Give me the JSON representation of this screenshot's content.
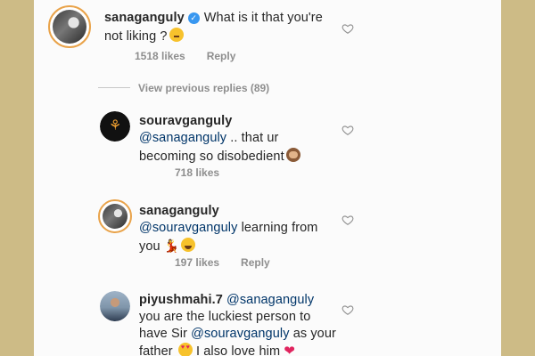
{
  "comments": [
    {
      "username": "sanaganguly",
      "verified": true,
      "text_line1": "What is it that you're",
      "text_line2": "not liking ?",
      "emoji": "thinking-face-icon",
      "likes": "1518 likes",
      "reply": "Reply"
    },
    {
      "username": "souravganguly",
      "mention": "@sanaganguly",
      "text_line1_rest": " .. that ur",
      "text_line2": "becoming so disobedient",
      "emoji": "see-no-evil-monkey-icon",
      "likes": "718 likes"
    },
    {
      "username": "sanaganguly",
      "mention": "@souravganguly",
      "text_line1_rest": " learning from",
      "text_line2": "you",
      "emoji": "dancer-and-laughing-icon",
      "likes": "197 likes",
      "reply": "Reply"
    },
    {
      "username": "piyushmahi.7",
      "mention": "@sanaganguly",
      "text_line2": "you are the luckiest person to",
      "text_line3_pre": "have Sir ",
      "text_line3_mention": "@souravganguly",
      "text_line3_post": " as your",
      "text_line4": "father",
      "text_line4_rest": " I also love him",
      "emoji": "heart-eyes-and-red-heart-icon"
    }
  ],
  "view_previous_replies": "View previous replies (89)",
  "colors": {
    "background": "#cdbb86",
    "panel": "#fbfbfb",
    "text": "#262626",
    "mention": "#003569",
    "meta": "#8e8e8e",
    "verified": "#3897f0"
  }
}
